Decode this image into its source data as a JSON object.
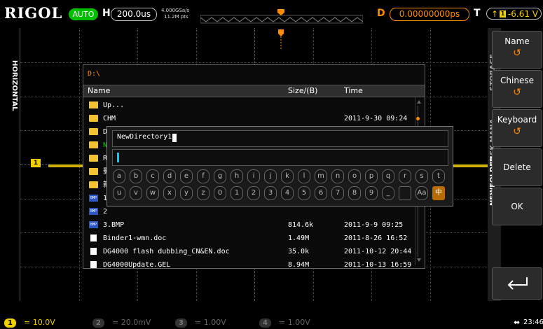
{
  "top": {
    "logo": "RIGOL",
    "mode": "AUTO",
    "h_label": "H",
    "timebase": "200.0us",
    "sample_rate": "4.000GSa/s",
    "mem_depth": "11.2M pts",
    "d_label": "D",
    "delay": "0.00000000ps",
    "t_label": "T",
    "trig_level": "-6.61 V"
  },
  "left_tab": {
    "label": "HORIZONTAL"
  },
  "ch1_marker": "1",
  "dialog": {
    "path": "D:\\",
    "columns": {
      "name": "Name",
      "size": "Size/(B)",
      "time": "Time"
    },
    "rows": [
      {
        "icon": "up",
        "name": "Up...",
        "size": "",
        "time": ""
      },
      {
        "icon": "folder",
        "name": "CHM",
        "size": "",
        "time": "2011-9-30 09:24"
      },
      {
        "icon": "folder",
        "name": "D",
        "size": "",
        "time": ""
      },
      {
        "icon": "folder",
        "name": "N",
        "size": "",
        "time": ""
      },
      {
        "icon": "folder",
        "name": "R",
        "size": "",
        "time": ""
      },
      {
        "icon": "folder",
        "name": "影",
        "size": "",
        "time": ""
      },
      {
        "icon": "folder",
        "name": "新",
        "size": "",
        "time": ""
      },
      {
        "icon": "bmp",
        "name": "1",
        "size": "",
        "time": ""
      },
      {
        "icon": "bmp",
        "name": "2",
        "size": "",
        "time": ""
      },
      {
        "icon": "bmp",
        "name": "3.BMP",
        "size": "814.6k",
        "time": "2011-9-9 09:25"
      },
      {
        "icon": "doc",
        "name": "Binder1-wmn.doc",
        "size": "1.49M",
        "time": "2011-8-26 16:52"
      },
      {
        "icon": "doc",
        "name": "DG4000 flash dubbing_CN&EN.doc",
        "size": "35.0k",
        "time": "2011-10-12 20:44"
      },
      {
        "icon": "doc",
        "name": "DG4000Update.GEL",
        "size": "8.94M",
        "time": "2011-10-13 16:59"
      }
    ]
  },
  "keyboard": {
    "name_value": "NewDirectory1",
    "input_value": "",
    "row1": [
      "a",
      "b",
      "c",
      "d",
      "e",
      "f",
      "g",
      "h",
      "i",
      "j",
      "k",
      "l",
      "m",
      "n",
      "o",
      "p",
      "q",
      "r",
      "s",
      "t"
    ],
    "row2": [
      "u",
      "v",
      "w",
      "x",
      "y",
      "z",
      "0",
      "1",
      "2",
      "3",
      "4",
      "5",
      "6",
      "7",
      "8",
      "9",
      "_",
      "",
      "Aa",
      "中"
    ]
  },
  "right_panel": {
    "tabs": [
      "STORAGE",
      "DISK MANA.",
      "NEWFOLDER"
    ],
    "keys": [
      {
        "label": "Name",
        "sub": "↺"
      },
      {
        "label": "Chinese",
        "sub": "↺"
      },
      {
        "label": "Keyboard",
        "sub": "↺"
      },
      {
        "label": "Delete",
        "sub": ""
      },
      {
        "label": "OK",
        "sub": ""
      }
    ],
    "back_icon": "return-arrow"
  },
  "bottom": {
    "ch1": {
      "num": "1",
      "value": "10.0V"
    },
    "ch2": {
      "num": "2",
      "value": "20.0mV"
    },
    "ch3": {
      "num": "3",
      "value": "1.00V"
    },
    "ch4": {
      "num": "4",
      "value": "1.00V"
    },
    "usb_icon": "usb-icon",
    "time": "23:46"
  },
  "colors": {
    "ch1": "#f0d000",
    "accent": "#ff8c00",
    "auto": "#00c000"
  }
}
